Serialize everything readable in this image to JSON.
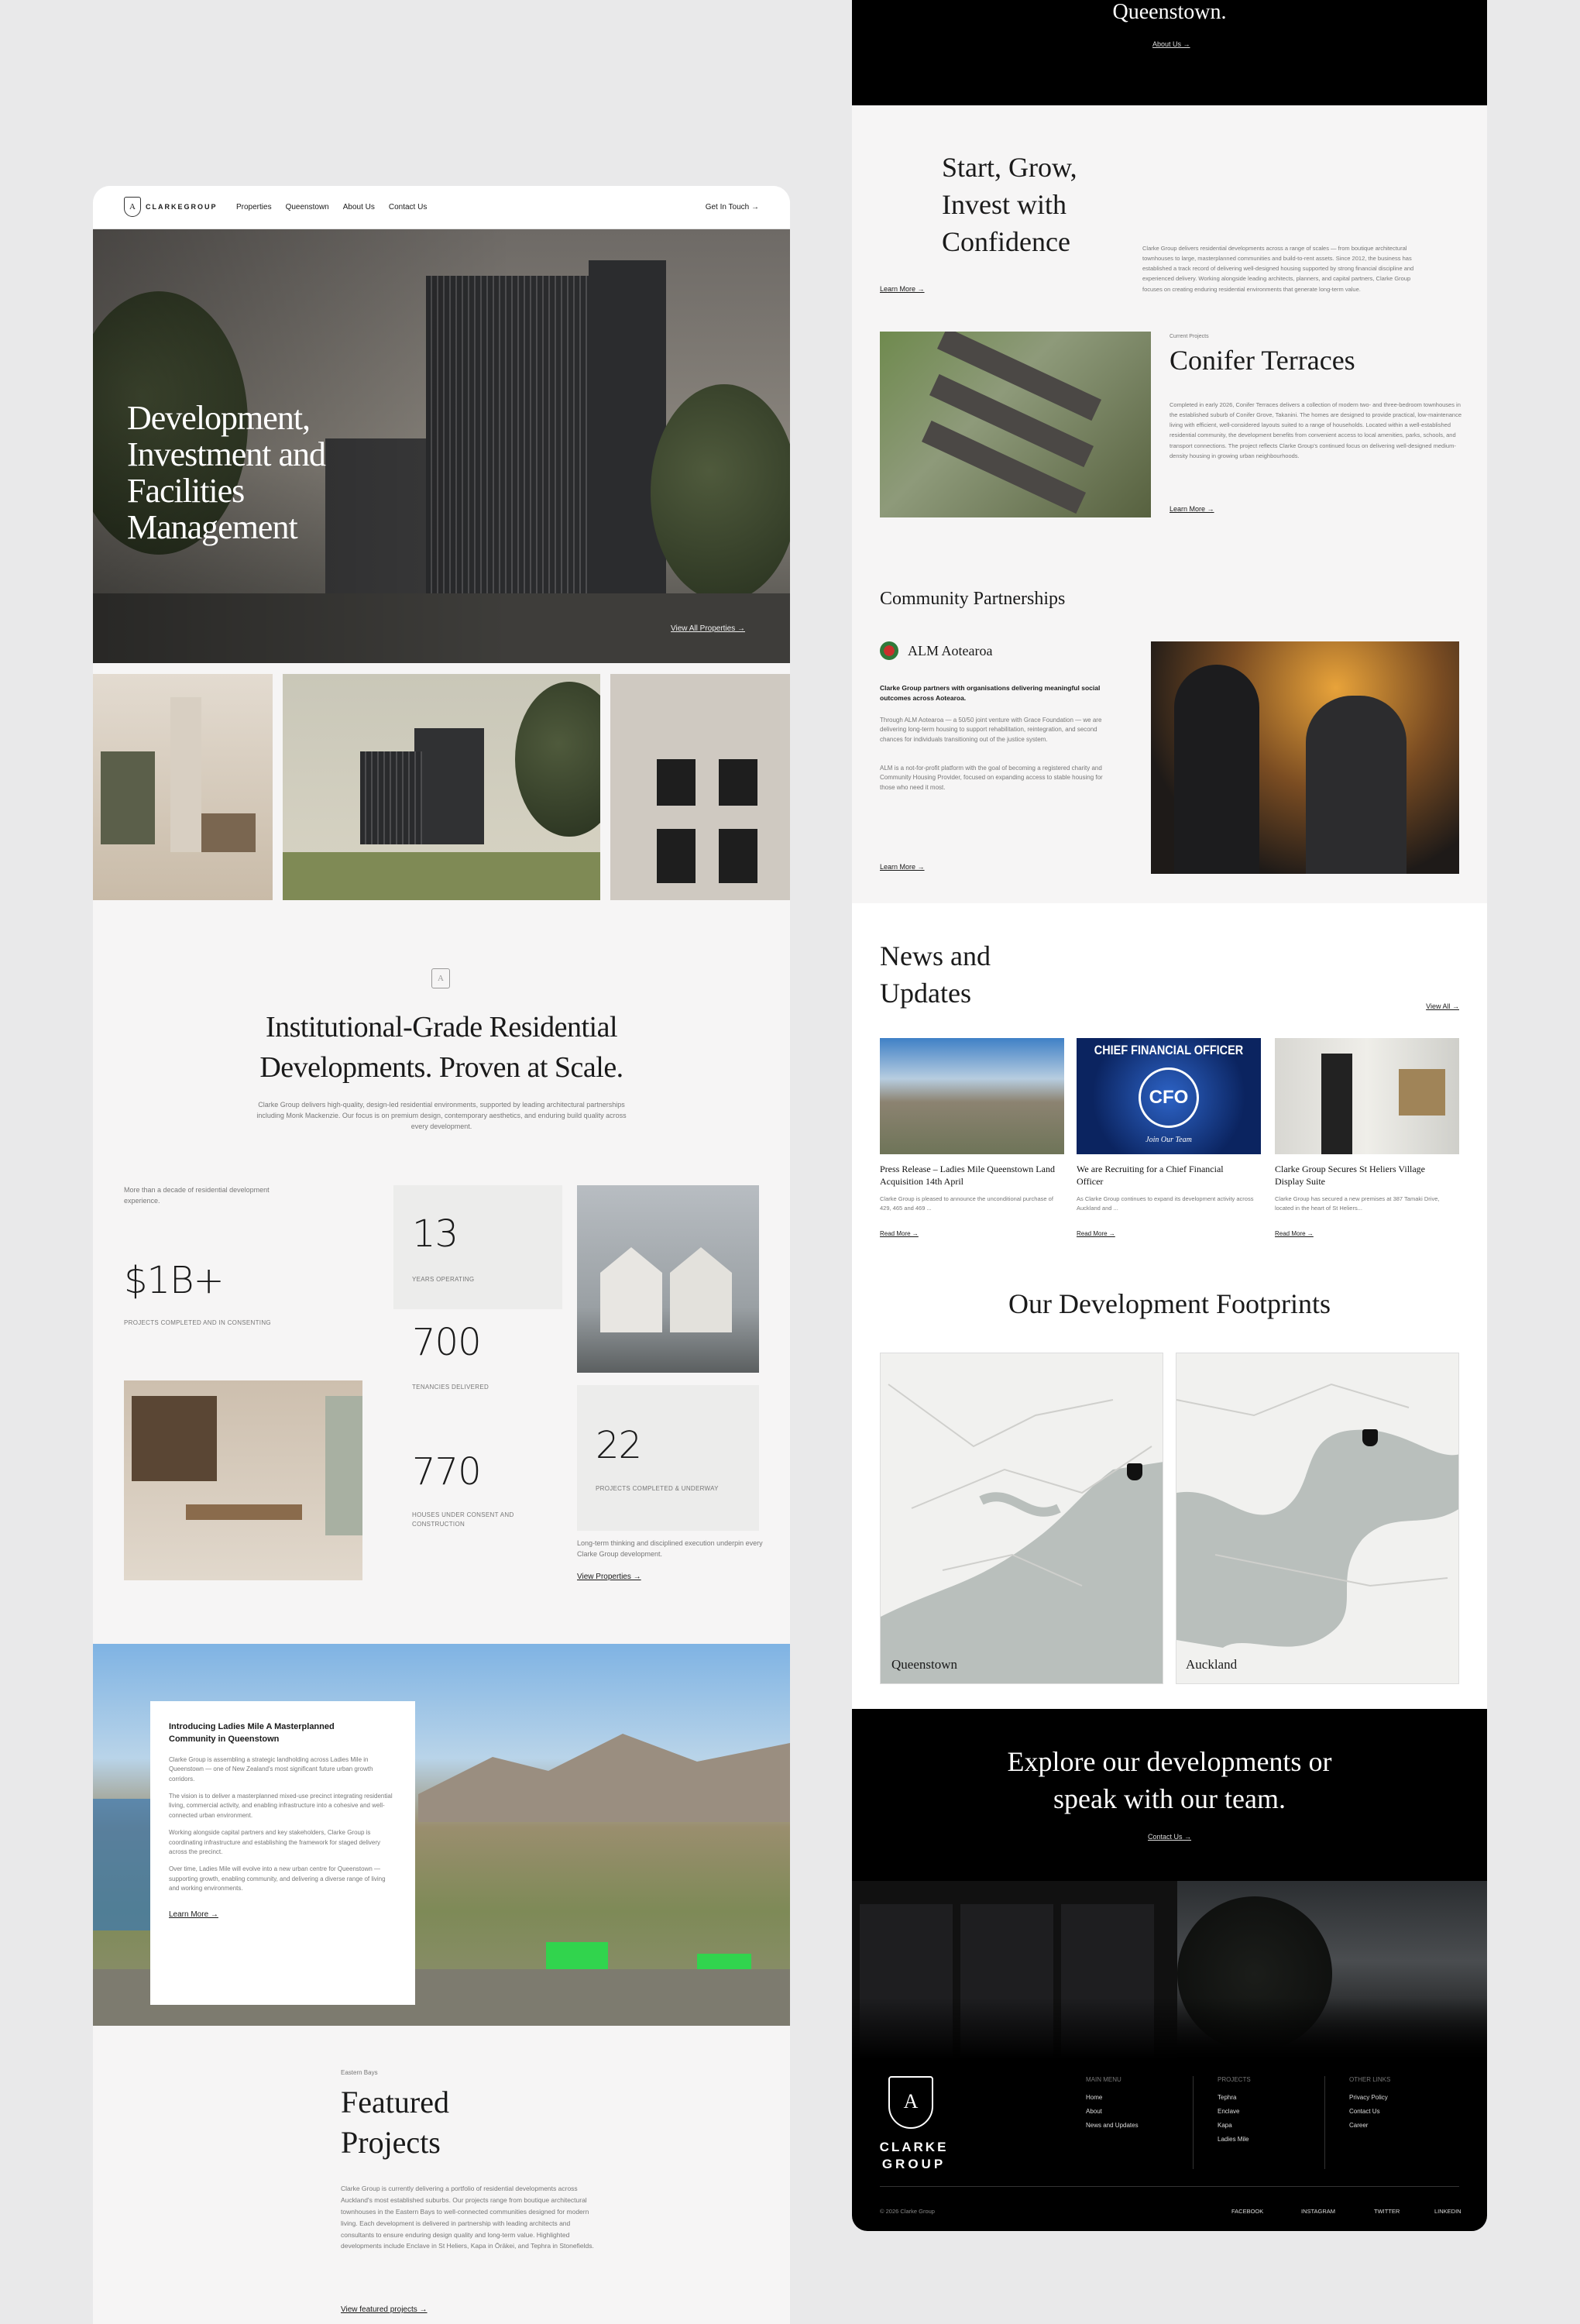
{
  "nav": {
    "logo": "CLARKEGROUP",
    "items": [
      "Properties",
      "Queenstown",
      "About Us",
      "Contact Us"
    ],
    "cta": "Get In Touch →"
  },
  "hero": {
    "title": "Development, Investment and Facilities Management",
    "link": "View All Properties →"
  },
  "intro": {
    "title": "Institutional-Grade Residential Developments. Proven at Scale.",
    "body": "Clarke Group delivers high-quality, design-led residential environments, supported by leading architectural partnerships including Monk Mackenzie. Our focus is on premium design, contemporary aesthetics, and enduring build quality across every development."
  },
  "stats": {
    "experience": "More than a decade of residential development experience.",
    "big_value": "$1B+",
    "big_label": "PROJECTS COMPLETED AND IN CONSENTING",
    "years_value": "13",
    "years_label": "YEARS OPERATING",
    "tenancies_value": "700",
    "tenancies_label": "TENANCIES DELIVERED",
    "houses_value": "770",
    "houses_label": "HOUSES UNDER CONSENT AND CONSTRUCTION",
    "projects_value": "22",
    "projects_label": "PROJECTS COMPLETED & UNDERWAY",
    "thinking": "Long-term thinking and disciplined execution underpin every Clarke Group development.",
    "link": "View Properties →"
  },
  "ladies_mile": {
    "title": "Introducing Ladies Mile A Masterplanned Community in Queenstown",
    "p1": "Clarke Group is assembling a strategic landholding across Ladies Mile in Queenstown — one of New Zealand's most significant future urban growth corridors.",
    "p2": "The vision is to deliver a masterplanned mixed-use precinct integrating residential living, commercial activity, and enabling infrastructure into a cohesive and well-connected urban environment.",
    "p3": "Working alongside capital partners and key stakeholders, Clarke Group is coordinating infrastructure and establishing the framework for staged delivery across the precinct.",
    "p4": "Over time, Ladies Mile will evolve into a new urban centre for Queenstown — supporting growth, enabling community, and delivering a diverse range of living and working environments.",
    "link": "Learn More →"
  },
  "featured": {
    "eyebrow": "Eastern Bays",
    "title": "Featured Projects",
    "body": "Clarke Group is currently delivering a portfolio of residential developments across Auckland's most established suburbs. Our projects range from boutique architectural townhouses in the Eastern Bays to well-connected communities designed for modern living. Each development is delivered in partnership with leading architects and consultants to ensure enduring design quality and long-term value. Highlighted developments include Enclave in St Heliers, Kapa in Ōrākei, and Tephra in Stonefields.",
    "link": "View featured projects →"
  },
  "right_top": {
    "title": "Queenstown.",
    "link": "About Us →"
  },
  "grow": {
    "title": "Start, Grow, Invest with Confidence",
    "body": "Clarke Group delivers residential developments across a range of scales — from boutique architectural townhouses to large, masterplanned communities and build-to-rent assets. Since 2012, the business has established a track record of delivering well-designed housing supported by strong financial discipline and experienced delivery. Working alongside leading architects, planners, and capital partners, Clarke Group focuses on creating enduring residential environments that generate long-term value.",
    "link": "Learn More →"
  },
  "conifer": {
    "eyebrow": "Current Projects",
    "title": "Conifer Terraces",
    "body": "Completed in early 2026, Conifer Terraces delivers a collection of modern two- and three-bedroom townhouses in the established suburb of Conifer Grove, Takanini. The homes are designed to provide practical, low-maintenance living with efficient, well-considered layouts suited to a range of households. Located within a well-established residential community, the development benefits from convenient access to local amenities, parks, schools, and transport connections. The project reflects Clarke Group's continued focus on delivering well-designed medium-density housing in growing urban neighbourhoods.",
    "link": "Learn More →"
  },
  "community": {
    "title": "Community Partnerships",
    "org": "ALM Aotearoa",
    "lead": "Clarke Group partners with organisations delivering meaningful social outcomes across Aotearoa.",
    "p1": "Through ALM Aotearoa — a 50/50 joint venture with Grace Foundation — we are delivering long-term housing to support rehabilitation, reintegration, and second chances for individuals transitioning out of the justice system.",
    "p2": "ALM is a not-for-profit platform with the goal of becoming a registered charity and Community Housing Provider, focused on expanding access to stable housing for those who need it most.",
    "link": "Learn More →"
  },
  "news": {
    "title": "News and Updates",
    "view_all": "View All →",
    "cfo_banner": "CHIEF FINANCIAL OFFICER",
    "cfo_badge": "CFO",
    "cfo_join": "Join Our Team",
    "items": [
      {
        "title": "Press Release – Ladies Mile Queenstown Land Acquisition 14th April",
        "body": "Clarke Group is pleased to announce the unconditional purchase of 429, 465 and 469 ...",
        "link": "Read More →"
      },
      {
        "title": "We are Recruiting for a Chief Financial Officer",
        "body": "As Clarke Group continues to expand its development activity across Auckland and ...",
        "link": "Read More →"
      },
      {
        "title": "Clarke Group Secures St Heliers Village Display Suite",
        "body": "Clarke Group has secured a new premises at 387 Tamaki Drive, located in the heart of St Heliers...",
        "link": "Read More →"
      }
    ]
  },
  "footprints": {
    "title": "Our Development Footprints",
    "maps": [
      "Queenstown",
      "Auckland"
    ]
  },
  "explore": {
    "title": "Explore our developments or speak with our team.",
    "link": "Contact Us →"
  },
  "footer": {
    "logo_line1": "CLARKE",
    "logo_line2": "GROUP",
    "cols": [
      {
        "heading": "MAIN MENU",
        "items": [
          "Home",
          "About",
          "News and Updates"
        ]
      },
      {
        "heading": "PROJECTS",
        "items": [
          "Tephra",
          "Enclave",
          "Kapa",
          "Ladies Mile"
        ]
      },
      {
        "heading": "OTHER LINKS",
        "items": [
          "Privacy Policy",
          "Contact Us",
          "Career"
        ]
      }
    ],
    "copyright": "© 2026 Clarke Group",
    "social": [
      "FACEBOOK",
      "INSTAGRAM",
      "TWITTER",
      "LINKEDIN"
    ]
  },
  "colors": {
    "page_bg": "#e9e9ea",
    "panel_bg": "#f6f5f5",
    "dark": "#000000",
    "accent_green": "#22e04a"
  }
}
